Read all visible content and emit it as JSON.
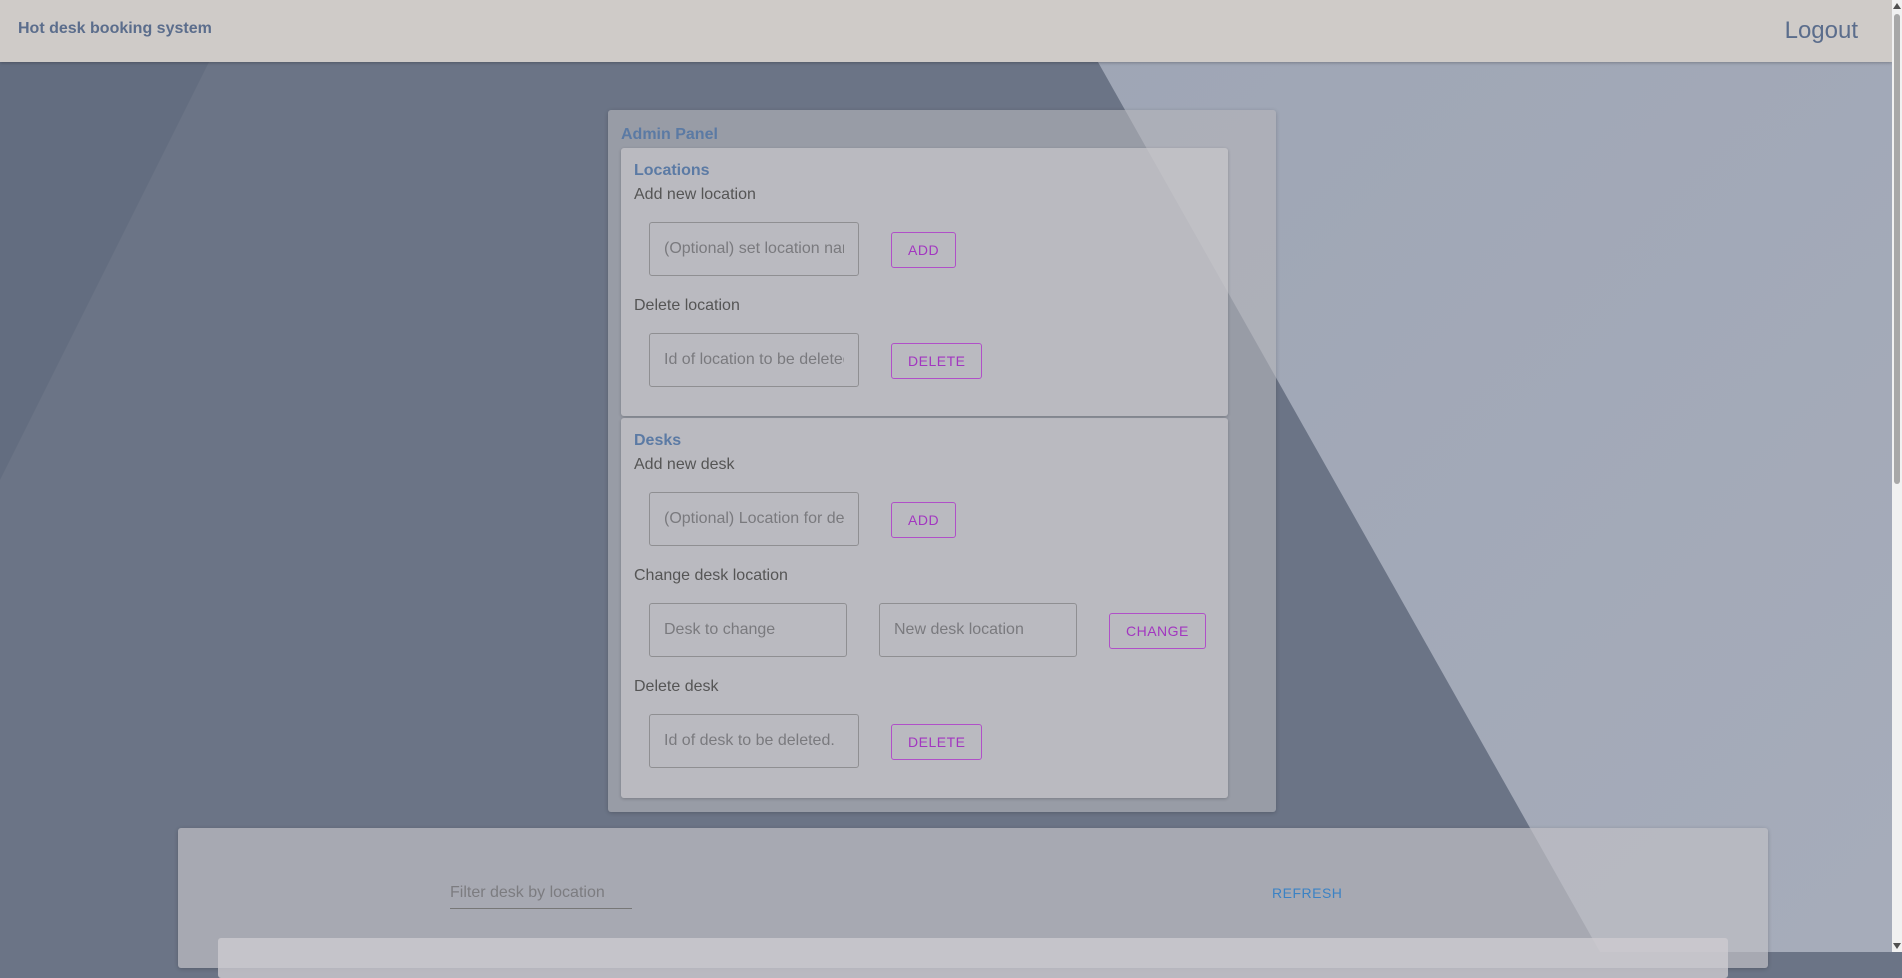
{
  "app": {
    "title": "Hot desk booking system",
    "logout_label": "Logout"
  },
  "admin_panel": {
    "title": "Admin Panel",
    "locations": {
      "title": "Locations",
      "add_label": "Add new location",
      "add_placeholder": "(Optional) set location name",
      "add_button": "ADD",
      "delete_label": "Delete location",
      "delete_placeholder": "Id of location to be deleted.",
      "delete_button": "DELETE"
    },
    "desks": {
      "title": "Desks",
      "add_label": "Add new desk",
      "add_placeholder": "(Optional) Location for desk",
      "add_button": "ADD",
      "change_label": "Change desk location",
      "change_desk_placeholder": "Desk to change",
      "change_location_placeholder": "New desk location",
      "change_button": "CHANGE",
      "delete_label": "Delete desk",
      "delete_placeholder": "Id of desk to be deleted.",
      "delete_button": "DELETE"
    }
  },
  "desk_list": {
    "filter_placeholder": "Filter desk by location",
    "refresh_button": "REFRESH"
  }
}
